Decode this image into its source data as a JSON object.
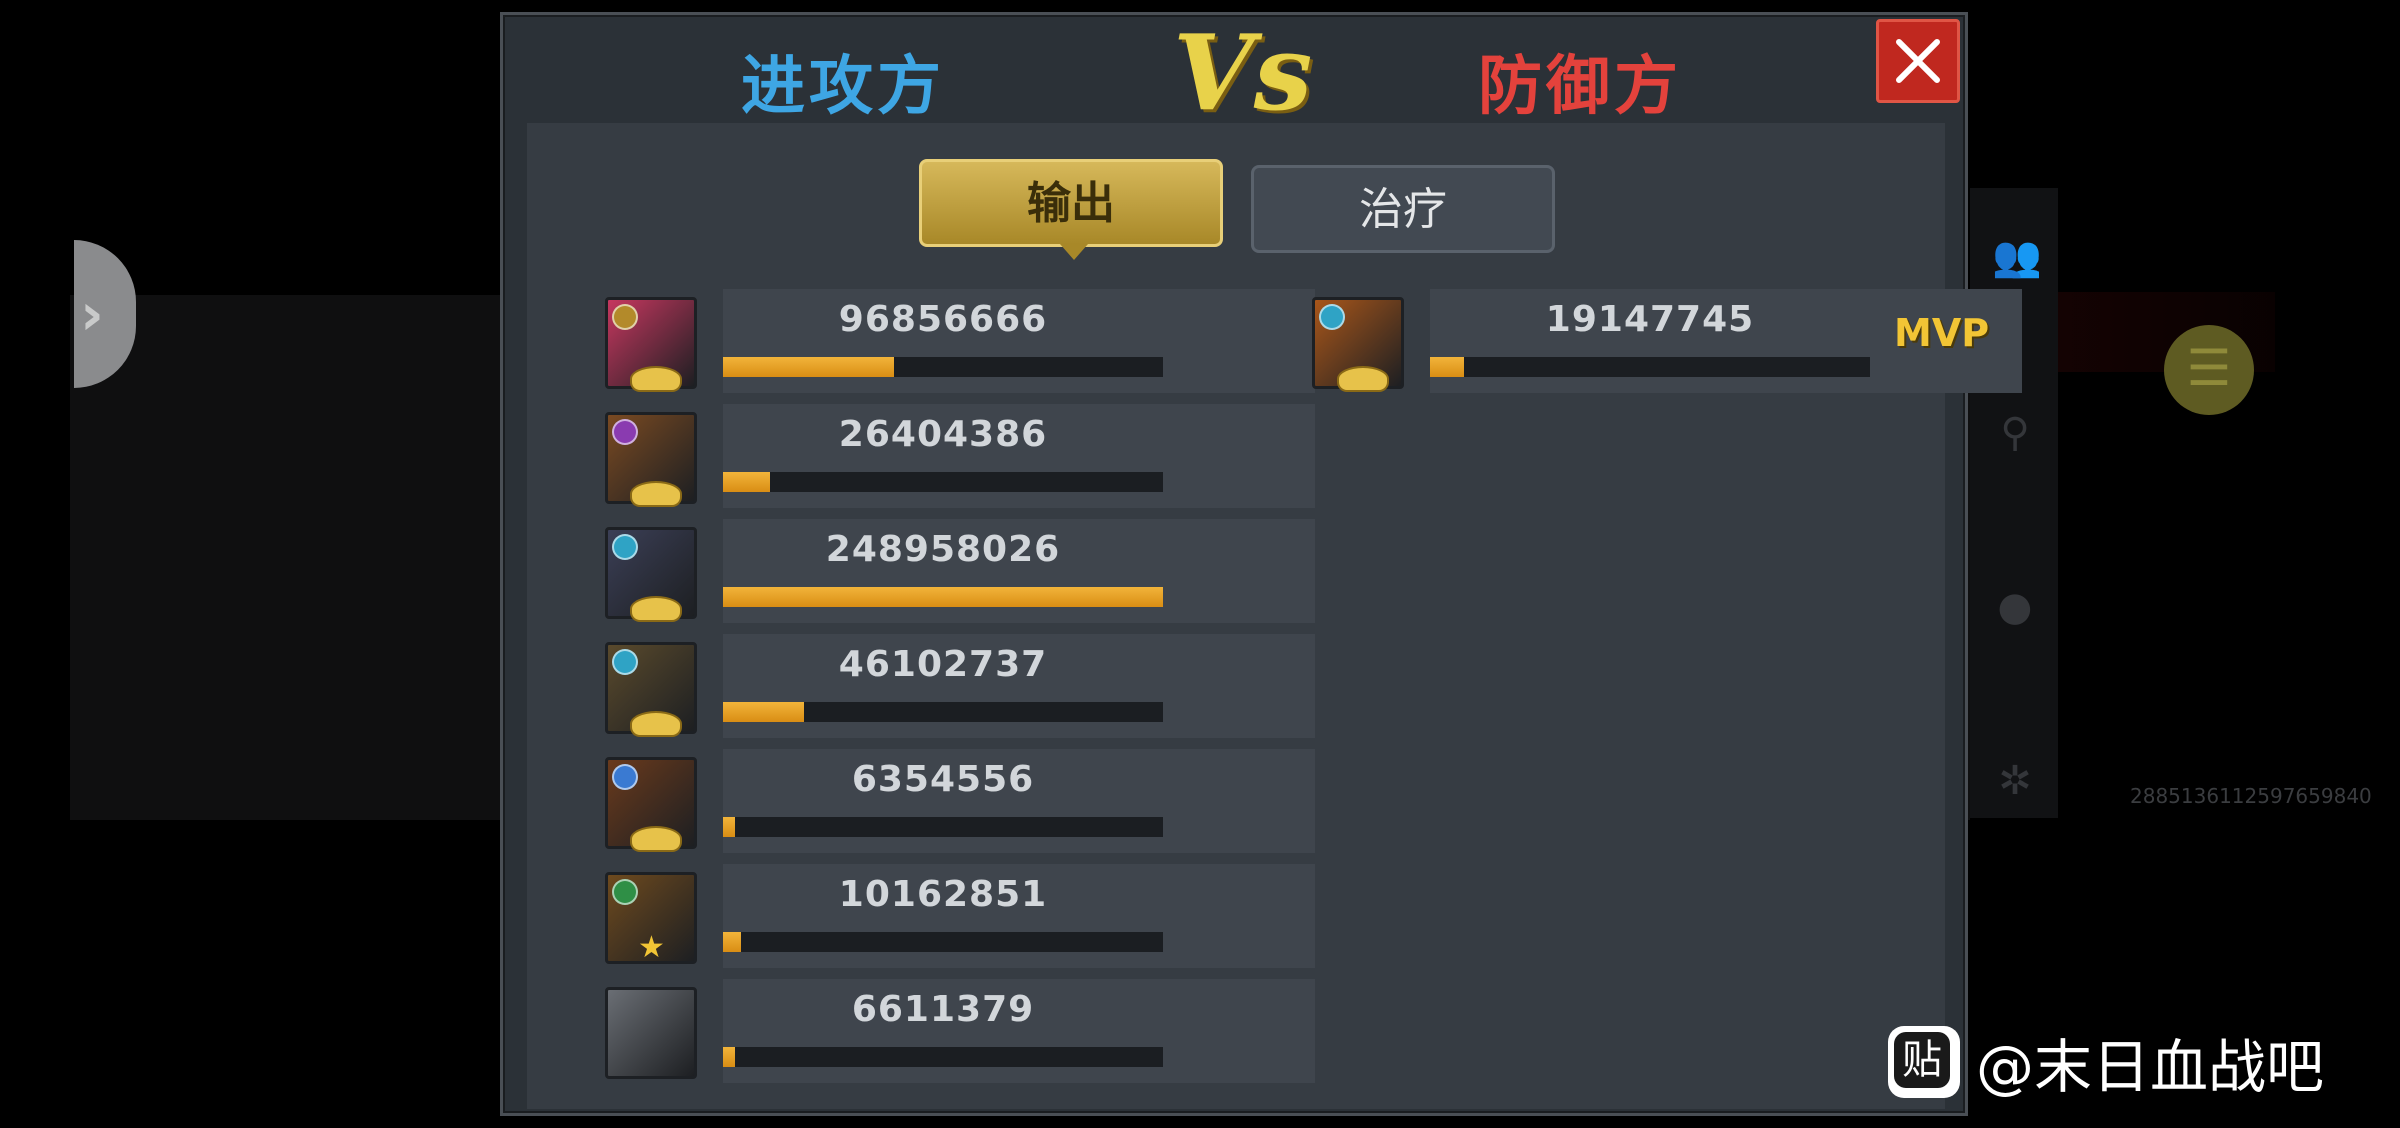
{
  "header": {
    "attacker_label": "进攻方",
    "vs_label": "Vs",
    "defender_label": "防御方",
    "close_icon": "close-icon"
  },
  "tabs": {
    "active": "damage",
    "damage_label": "输出",
    "heal_label": "治疗"
  },
  "attackers": [
    {
      "value": "96856666",
      "fill": 0.389,
      "avatar_color": "#c6375f",
      "badge_color": "#b38a2a",
      "avatar": "hero-portrait-pink-hair",
      "rank": "crest"
    },
    {
      "value": "26404386",
      "fill": 0.106,
      "avatar_color": "#7a4a22",
      "badge_color": "#8a3bb0",
      "avatar": "hero-portrait-armored",
      "rank": "crest"
    },
    {
      "value": "248958026",
      "fill": 1.0,
      "avatar_color": "#3b3f56",
      "badge_color": "#2fa3c5",
      "avatar": "hero-portrait-dark-beast",
      "rank": "crest"
    },
    {
      "value": "46102737",
      "fill": 0.185,
      "avatar_color": "#5a4a2c",
      "badge_color": "#2fa3c5",
      "avatar": "hero-portrait-masked",
      "rank": "crest"
    },
    {
      "value": "6354556",
      "fill": 0.026,
      "avatar_color": "#6a3a1c",
      "badge_color": "#3a7ad2",
      "avatar": "hero-portrait-blonde",
      "rank": "crest"
    },
    {
      "value": "10162851",
      "fill": 0.041,
      "avatar_color": "#6e4a1e",
      "badge_color": "#2f8f46",
      "avatar": "hero-portrait-warrior",
      "rank": "star"
    },
    {
      "value": "6611379",
      "fill": 0.027,
      "avatar_color": "#6a6e74",
      "badge_color": "",
      "avatar": "vehicle-portrait",
      "rank": "none"
    }
  ],
  "defenders": [
    {
      "value": "19147745",
      "fill": 0.077,
      "mvp": "MVP",
      "avatar_color": "#a8561a",
      "badge_color": "#2fa3c5",
      "avatar": "hero-portrait-fire-beast",
      "rank": "crest"
    }
  ],
  "background": {
    "id_text": "288513611259765984​0"
  },
  "watermark": {
    "icon_text": "贴",
    "text": "@末日血战吧"
  },
  "colors": {
    "attacker": "#3ea6e4",
    "defender": "#e4423c",
    "accent_gold": "#f2c535"
  }
}
